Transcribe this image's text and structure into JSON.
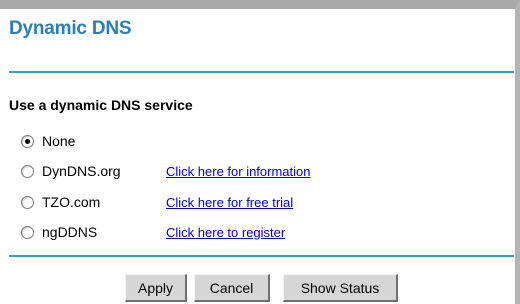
{
  "page": {
    "title": "Dynamic DNS"
  },
  "ddns": {
    "heading": "Use a dynamic DNS service",
    "selected": "None",
    "options": [
      {
        "label": "None",
        "checked": true,
        "link": ""
      },
      {
        "label": "DynDNS.org",
        "checked": false,
        "link": "Click here for information"
      },
      {
        "label": "TZO.com",
        "checked": false,
        "link": "Click here for free trial"
      },
      {
        "label": "ngDDNS",
        "checked": false,
        "link": "Click here to register"
      }
    ]
  },
  "buttons": {
    "apply": "Apply",
    "cancel": "Cancel",
    "show_status": "Show Status"
  },
  "colors": {
    "title": "#2b7fb8",
    "rule": "#33a5ad",
    "link": "#0000cc",
    "button_face": "#d6d6d6"
  }
}
